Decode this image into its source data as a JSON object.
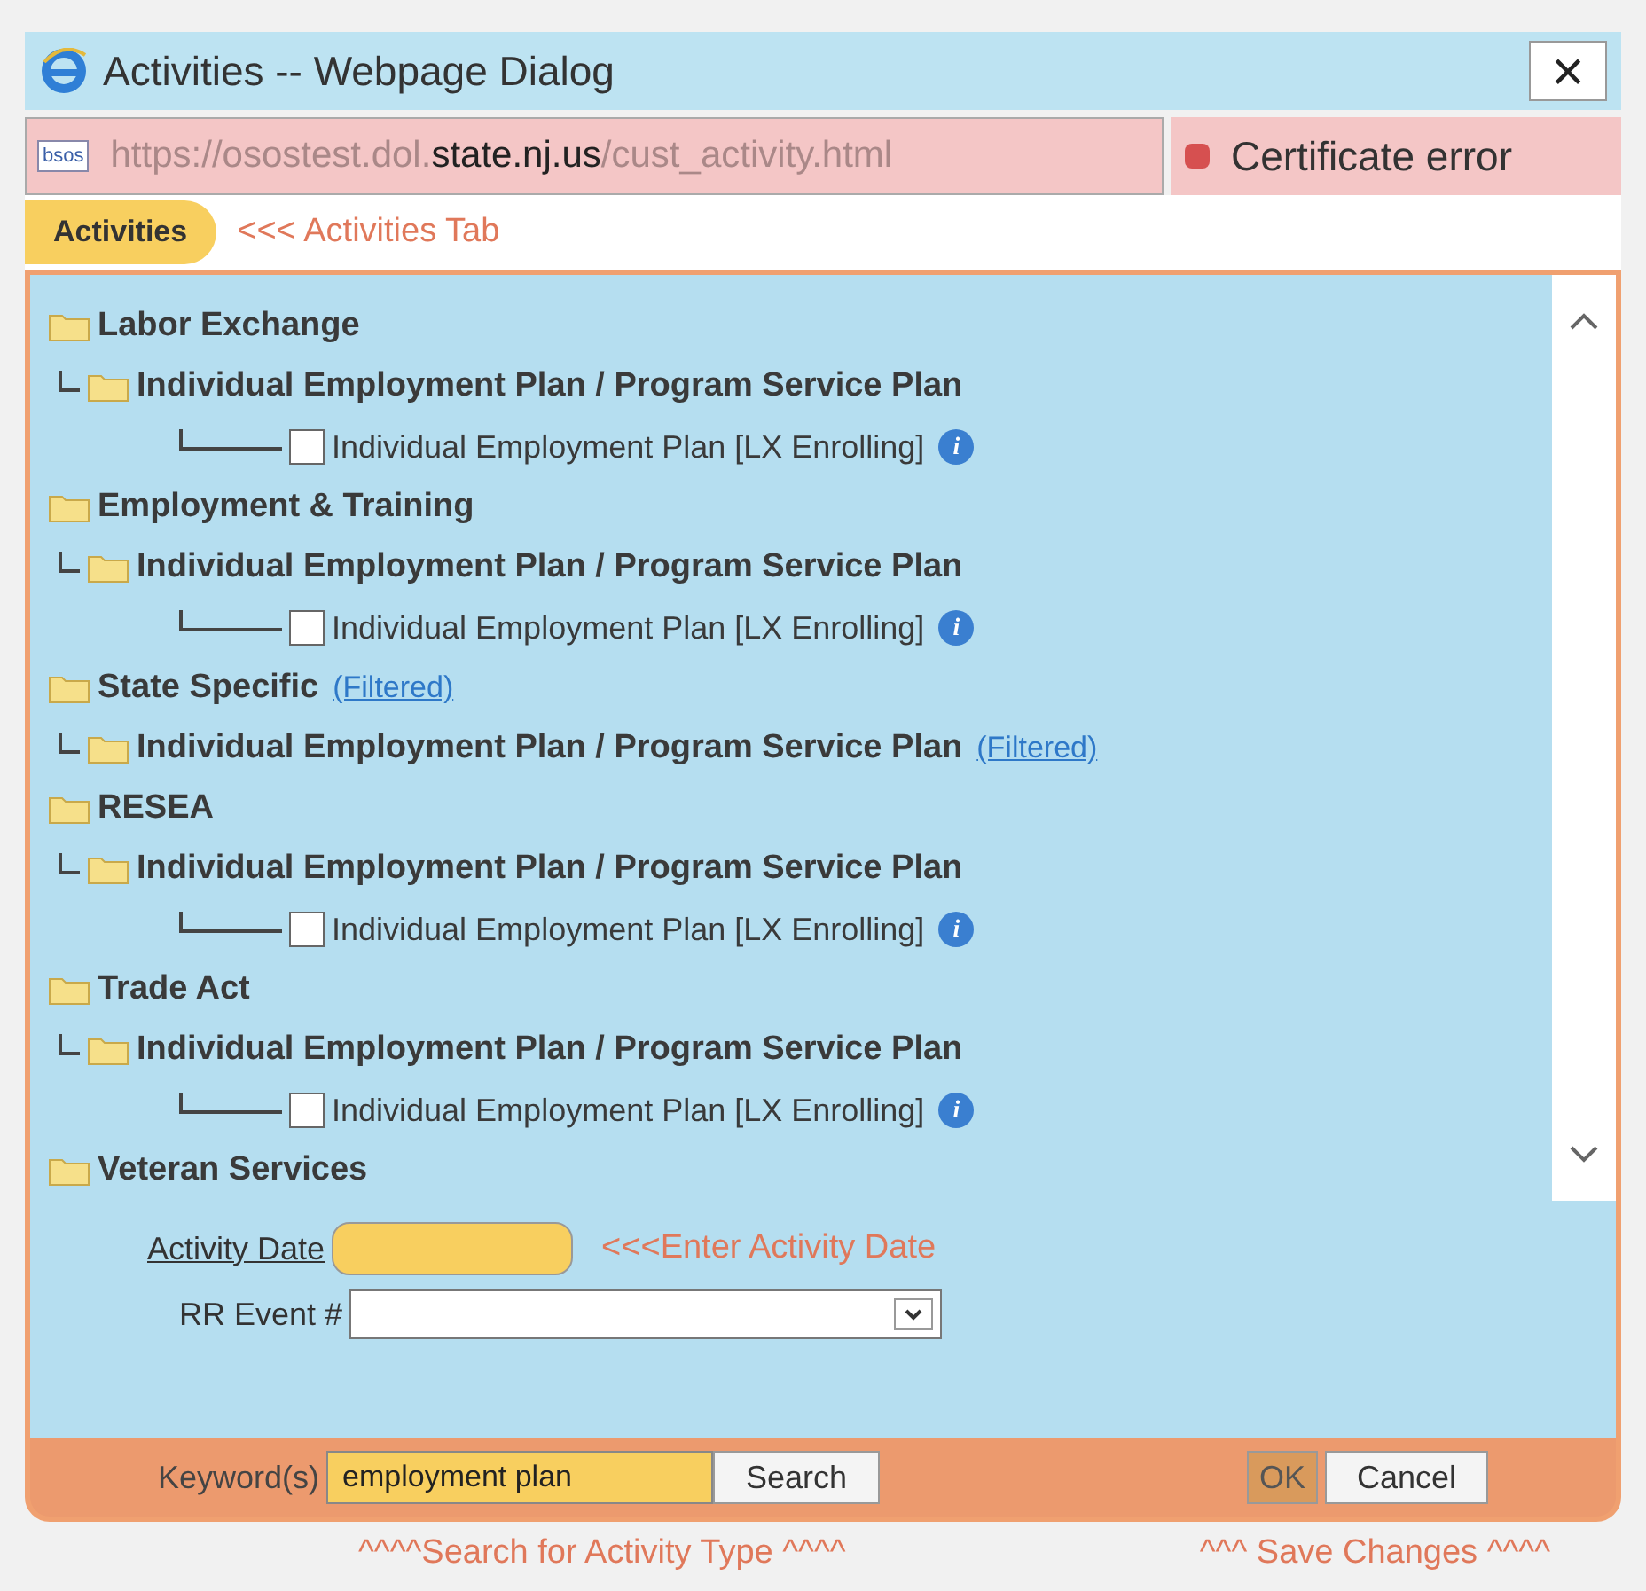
{
  "window": {
    "title": "Activities -- Webpage Dialog",
    "close": "×"
  },
  "address_bar": {
    "url_start": "https://osostest.dol.",
    "url_domain": "state.nj.us",
    "url_end": "/cust_activity.html",
    "site_badge": "bsos",
    "certificate": "Certificate error"
  },
  "tabs": [
    {
      "label": "Activities",
      "selected": true
    }
  ],
  "tab_note": "<<< Activities Tab",
  "tree": [
    {
      "label": "Labor Exchange",
      "children": [
        {
          "label": "Individual Employment Plan / Program Service Plan",
          "children": [
            {
              "label": "Individual Employment Plan [LX Enrolling]",
              "checked": false,
              "info": "i"
            }
          ]
        }
      ]
    },
    {
      "label": "Employment & Training",
      "children": [
        {
          "label": "Individual Employment Plan / Program Service Plan",
          "children": [
            {
              "label": "Individual Employment Plan [LX Enrolling]",
              "checked": false,
              "info": "i"
            }
          ]
        }
      ]
    },
    {
      "label": "State Specific",
      "link": "(Filtered)",
      "children": [
        {
          "label": "Individual Employment Plan / Program Service Plan",
          "link": "(Filtered)"
        }
      ]
    },
    {
      "label": "RESEA",
      "children": [
        {
          "label": "Individual Employment Plan / Program Service Plan",
          "children": [
            {
              "label": "Individual Employment Plan [LX Enrolling]",
              "checked": false,
              "info": "i"
            }
          ]
        }
      ]
    },
    {
      "label": "Trade Act",
      "children": [
        {
          "label": "Individual Employment Plan / Program Service Plan",
          "children": [
            {
              "label": "Individual Employment Plan [LX Enrolling]",
              "checked": false,
              "info": "i"
            }
          ]
        }
      ]
    },
    {
      "label": "Veteran Services"
    }
  ],
  "form": {
    "activity_date_label": "Activity Date",
    "activity_date_note": "<<<Enter Activity Date",
    "rr_event_label": "RR Event #"
  },
  "footer": {
    "keyword_label": "Keyword(s)",
    "keyword_value": "employment plan",
    "search": "Search",
    "ok": "OK",
    "cancel": "Cancel"
  },
  "notes": [
    "^^^^Search for Activity Type ^^^^",
    "^^^ Save Changes ^^^^"
  ]
}
